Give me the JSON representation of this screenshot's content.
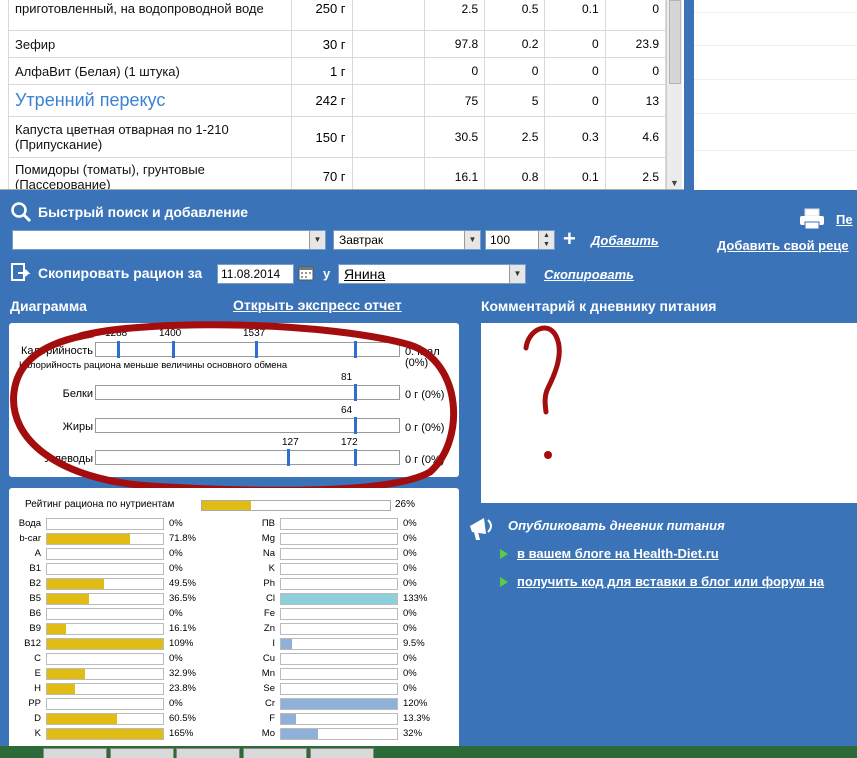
{
  "food_table": {
    "rows": [
      {
        "name": "приготовленный, на водопроводной воде",
        "qty": "250 г",
        "cal": "2.5",
        "p": "0.5",
        "f": "0.1",
        "c": "0",
        "type": "food"
      },
      {
        "name": "Зефир",
        "qty": "30 г",
        "cal": "97.8",
        "p": "0.2",
        "f": "0",
        "c": "23.9",
        "type": "food"
      },
      {
        "name": "АлфаВит (Белая) (1 штука)",
        "qty": "1 г",
        "cal": "0",
        "p": "0",
        "f": "0",
        "c": "0",
        "type": "food"
      },
      {
        "name": "Утренний перекус",
        "qty": "242 г",
        "cal": "75",
        "p": "5",
        "f": "0",
        "c": "13",
        "type": "meal"
      },
      {
        "name": "Капуста цветная отварная по 1-210 (Припускание)",
        "qty": "150 г",
        "cal": "30.5",
        "p": "2.5",
        "f": "0.3",
        "c": "4.6",
        "type": "food"
      },
      {
        "name": "Помидоры (томаты), грунтовые (Пассерование)",
        "qty": "70 г",
        "cal": "16.1",
        "p": "0.8",
        "f": "0.1",
        "c": "2.5",
        "type": "food"
      }
    ]
  },
  "search": {
    "title": "Быстрый поиск и добавление",
    "meal_value": "Завтрак",
    "qty_value": "100",
    "add_label": "Добавить",
    "print_label": "Пе",
    "add_recipe_label": "Добавить свой реце"
  },
  "copy": {
    "title": "Скопировать рацион за",
    "date": "11.08.2014",
    "u_label": "у",
    "user": "Янина",
    "copy_label": "Скопировать"
  },
  "diagram": {
    "title": "Диаграмма",
    "express_link": "Открыть экспресс отчет",
    "note": "Калорийность рациона меньше величины основного обмена",
    "rows": [
      {
        "label": "Калорийность",
        "value": "0. ккал",
        "pct": "(0%)"
      },
      {
        "label": "Белки",
        "value": "0 г (0%)"
      },
      {
        "label": "Жиры",
        "value": "0 г (0%)"
      },
      {
        "label": "Углеводы",
        "value": "0 г (0%)"
      }
    ],
    "ticks": {
      "b": "81",
      "f": "64",
      "c1": "127",
      "c2": "172",
      "cal1": "1288",
      "cal2": "1400",
      "cal3": "1537"
    }
  },
  "comment": {
    "title": "Комментарий к дневнику питания"
  },
  "rating": {
    "label": "Рейтинг рациона по нутриентам",
    "value": "26%",
    "fraction": 0.26
  },
  "nutrients_left": [
    {
      "name": "Вода",
      "val": "0%",
      "frac": 0,
      "color": "#e0bc14"
    },
    {
      "name": "b-car",
      "val": "71.8%",
      "frac": 0.718,
      "color": "#e0bc14"
    },
    {
      "name": "A",
      "val": "0%",
      "frac": 0,
      "color": "#e0bc14"
    },
    {
      "name": "B1",
      "val": "0%",
      "frac": 0,
      "color": "#e0bc14"
    },
    {
      "name": "B2",
      "val": "49.5%",
      "frac": 0.495,
      "color": "#e0bc14"
    },
    {
      "name": "B5",
      "val": "36.5%",
      "frac": 0.365,
      "color": "#e0bc14"
    },
    {
      "name": "B6",
      "val": "0%",
      "frac": 0,
      "color": "#e0bc14"
    },
    {
      "name": "B9",
      "val": "16.1%",
      "frac": 0.161,
      "color": "#e0bc14"
    },
    {
      "name": "B12",
      "val": "109%",
      "frac": 1.0,
      "color": "#e0bc14"
    },
    {
      "name": "C",
      "val": "0%",
      "frac": 0,
      "color": "#e0bc14"
    },
    {
      "name": "E",
      "val": "32.9%",
      "frac": 0.329,
      "color": "#e0bc14"
    },
    {
      "name": "H",
      "val": "23.8%",
      "frac": 0.238,
      "color": "#e0bc14"
    },
    {
      "name": "PP",
      "val": "0%",
      "frac": 0,
      "color": "#e0bc14"
    },
    {
      "name": "D",
      "val": "60.5%",
      "frac": 0.605,
      "color": "#e0bc14"
    },
    {
      "name": "K",
      "val": "165%",
      "frac": 1.0,
      "color": "#e0bc14"
    }
  ],
  "nutrients_right": [
    {
      "name": "ПВ",
      "val": "0%",
      "frac": 0,
      "color": "#8fb0d8"
    },
    {
      "name": "Mg",
      "val": "0%",
      "frac": 0,
      "color": "#8fb0d8"
    },
    {
      "name": "Na",
      "val": "0%",
      "frac": 0,
      "color": "#8fb0d8"
    },
    {
      "name": "K",
      "val": "0%",
      "frac": 0,
      "color": "#8fb0d8"
    },
    {
      "name": "Ph",
      "val": "0%",
      "frac": 0,
      "color": "#8fb0d8"
    },
    {
      "name": "Cl",
      "val": "133%",
      "frac": 1.0,
      "color": "#8ecfdc"
    },
    {
      "name": "Fe",
      "val": "0%",
      "frac": 0,
      "color": "#8fb0d8"
    },
    {
      "name": "Zn",
      "val": "0%",
      "frac": 0,
      "color": "#8fb0d8"
    },
    {
      "name": "I",
      "val": "9.5%",
      "frac": 0.095,
      "color": "#8fb0d8"
    },
    {
      "name": "Cu",
      "val": "0%",
      "frac": 0,
      "color": "#8fb0d8"
    },
    {
      "name": "Mn",
      "val": "0%",
      "frac": 0,
      "color": "#8fb0d8"
    },
    {
      "name": "Se",
      "val": "0%",
      "frac": 0,
      "color": "#8fb0d8"
    },
    {
      "name": "Cr",
      "val": "120%",
      "frac": 1.0,
      "color": "#8fb0d8"
    },
    {
      "name": "F",
      "val": "13.3%",
      "frac": 0.133,
      "color": "#8fb0d8"
    },
    {
      "name": "Mo",
      "val": "32%",
      "frac": 0.32,
      "color": "#8fb0d8"
    }
  ],
  "publish": {
    "title": "Опубликовать дневник питания",
    "link1": "в вашем блоге на Health-Diet.ru",
    "link2": "получить код для вставки в блог или форум на"
  },
  "colors": {
    "bg": "#3a73b8",
    "marker": "#2d6fd2",
    "annotation": "#a30d0d",
    "meal_text": "#3b82d6"
  }
}
